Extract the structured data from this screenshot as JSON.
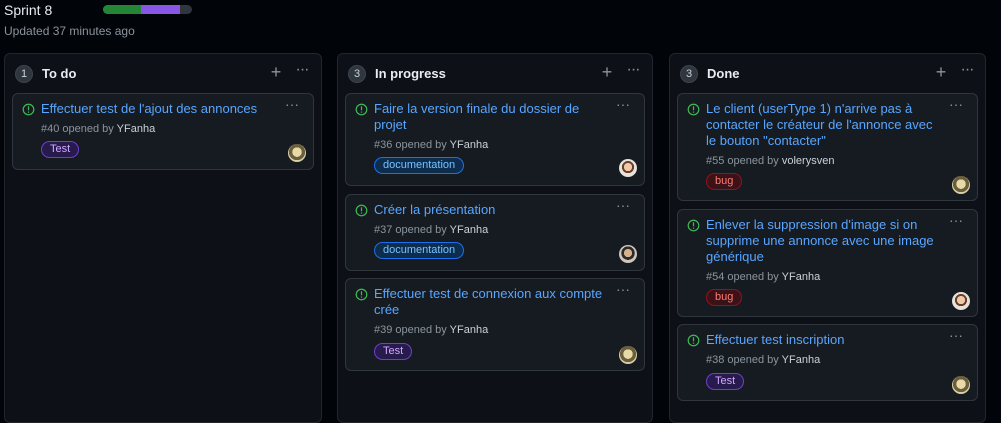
{
  "header": {
    "title": "Sprint 8",
    "updated": "Updated 37 minutes ago",
    "progress": {
      "done_fraction": 0.43,
      "in_progress_fraction": 0.43
    }
  },
  "colors": {
    "background": "#010409",
    "column_bg": "#0d1117",
    "card_bg": "#161b22",
    "link": "#58a6ff",
    "open_issue": "#3fb950",
    "progress_done": "#238636",
    "progress_in_progress": "#8957e5"
  },
  "columns": [
    {
      "count": "1",
      "title": "To do",
      "cards": [
        {
          "title": "Effectuer test de l'ajout des annonces",
          "number": "#40",
          "opened_by": "opened by",
          "user": "YFanha",
          "label": "Test",
          "icon": "open-issue-icon",
          "avatar": "avatar-yfanha"
        }
      ]
    },
    {
      "count": "3",
      "title": "In progress",
      "cards": [
        {
          "title": "Faire la version finale du dossier de projet",
          "number": "#36",
          "opened_by": "opened by",
          "user": "YFanha",
          "label": "documentation",
          "icon": "open-issue-icon",
          "avatar": "avatar-assignee"
        },
        {
          "title": "Créer la présentation",
          "number": "#37",
          "opened_by": "opened by",
          "user": "YFanha",
          "label": "documentation",
          "icon": "open-issue-icon",
          "avatar": "avatar-assignee-2"
        },
        {
          "title": "Effectuer test de connexion aux compte crée",
          "number": "#39",
          "opened_by": "opened by",
          "user": "YFanha",
          "label": "Test",
          "icon": "open-issue-icon",
          "avatar": "avatar-yfanha"
        }
      ]
    },
    {
      "count": "3",
      "title": "Done",
      "cards": [
        {
          "title": "Le client (userType 1) n'arrive pas à contacter le créateur de l'annonce avec le bouton \"contacter\"",
          "number": "#55",
          "opened_by": "opened by",
          "user": "volerysven",
          "label": "bug",
          "icon": "open-issue-icon",
          "avatar": "avatar-yfanha"
        },
        {
          "title": "Enlever la suppression d'image si on supprime une annonce avec une image générique",
          "number": "#54",
          "opened_by": "opened by",
          "user": "YFanha",
          "label": "bug",
          "icon": "open-issue-icon",
          "avatar": "avatar-assignee"
        },
        {
          "title": "Effectuer test inscription",
          "number": "#38",
          "opened_by": "opened by",
          "user": "YFanha",
          "label": "Test",
          "icon": "open-issue-icon",
          "avatar": "avatar-yfanha"
        }
      ]
    }
  ],
  "icons": {
    "add": "+",
    "more": "···"
  }
}
